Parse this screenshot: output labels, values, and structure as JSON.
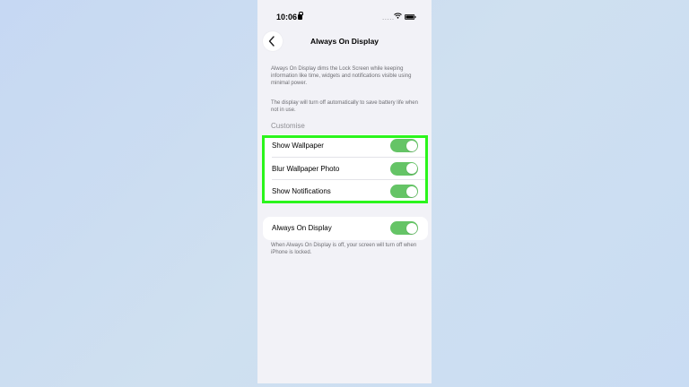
{
  "status_bar": {
    "time": "10:06",
    "signal": "....."
  },
  "nav": {
    "title": "Always On Display"
  },
  "descriptions": [
    "Always On Display dims the Lock Screen while keeping information like time, widgets and notifications visible using minimal power.",
    "The display will turn off automatically to save battery life when not in use."
  ],
  "customise": {
    "header": "Customise",
    "rows": [
      {
        "label": "Show Wallpaper",
        "on": true
      },
      {
        "label": "Blur Wallpaper Photo",
        "on": true
      },
      {
        "label": "Show Notifications",
        "on": true
      }
    ]
  },
  "aod": {
    "label": "Always On Display",
    "on": true,
    "footer": "When Always On Display is off, your screen will turn off when iPhone is locked."
  },
  "colors": {
    "toggle_on": "#65c466",
    "highlight": "#2bf51c",
    "background": "#f2f2f7"
  },
  "icons": {
    "back": "chevron-left-icon",
    "wifi": "wifi-icon",
    "battery": "battery-icon",
    "lock": "lock-icon"
  }
}
